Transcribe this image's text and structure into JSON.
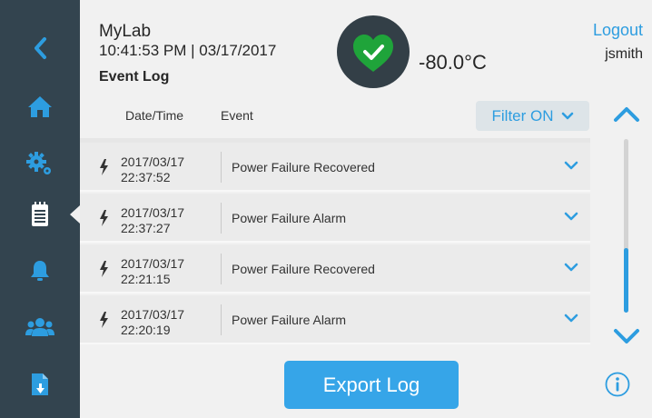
{
  "colors": {
    "sidebar": "#33444f",
    "accent": "#2d9de0",
    "status_ok": "#1fa43a",
    "status_bg": "#333f47"
  },
  "sidebar": {
    "items": [
      {
        "icon": "back-arrow-icon"
      },
      {
        "icon": "home-icon"
      },
      {
        "icon": "settings-gears-icon"
      },
      {
        "icon": "event-log-icon",
        "selected": true
      },
      {
        "icon": "alarm-bell-icon"
      },
      {
        "icon": "users-icon"
      },
      {
        "icon": "export-file-icon"
      }
    ]
  },
  "header": {
    "app_name": "MyLab",
    "datetime": "10:41:53 PM | 03/17/2017",
    "page_title": "Event Log",
    "status_icon": "heart-check-icon",
    "temperature": "-80.0°C",
    "logout": "Logout",
    "username": "jsmith"
  },
  "table": {
    "col_datetime": "Date/Time",
    "col_event": "Event",
    "filter_label": "Filter ON",
    "rows": [
      {
        "date": "2017/03/17",
        "time": "22:37:52",
        "event": "Power Failure Recovered"
      },
      {
        "date": "2017/03/17",
        "time": "22:37:27",
        "event": "Power Failure Alarm"
      },
      {
        "date": "2017/03/17",
        "time": "22:21:15",
        "event": "Power Failure Recovered"
      },
      {
        "date": "2017/03/17",
        "time": "22:20:19",
        "event": "Power Failure Alarm"
      }
    ]
  },
  "footer": {
    "export_label": "Export Log"
  }
}
